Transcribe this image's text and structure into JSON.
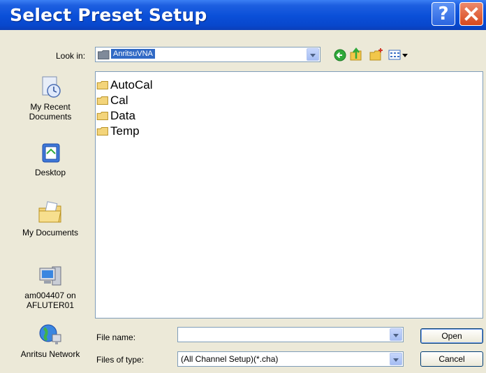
{
  "window": {
    "title": "Select Preset Setup"
  },
  "toolbar": {
    "look_in_label": "Look in:",
    "look_in_value": "AnritsuVNA"
  },
  "places": [
    {
      "label": "My Recent\nDocuments",
      "icon": "recent-documents-icon"
    },
    {
      "label": "Desktop",
      "icon": "desktop-icon"
    },
    {
      "label": "My Documents",
      "icon": "my-documents-icon"
    },
    {
      "label": "am004407 on\nAFLUTER01",
      "icon": "my-computer-icon"
    },
    {
      "label": "Anritsu Network",
      "icon": "network-icon"
    }
  ],
  "files": [
    "AutoCal",
    "Cal",
    "Data",
    "Temp"
  ],
  "bottom": {
    "file_name_label": "File name:",
    "file_name_value": "",
    "file_type_label": "Files of type:",
    "file_type_value": "(All Channel Setup)(*.cha)",
    "open_label": "Open",
    "cancel_label": "Cancel"
  }
}
